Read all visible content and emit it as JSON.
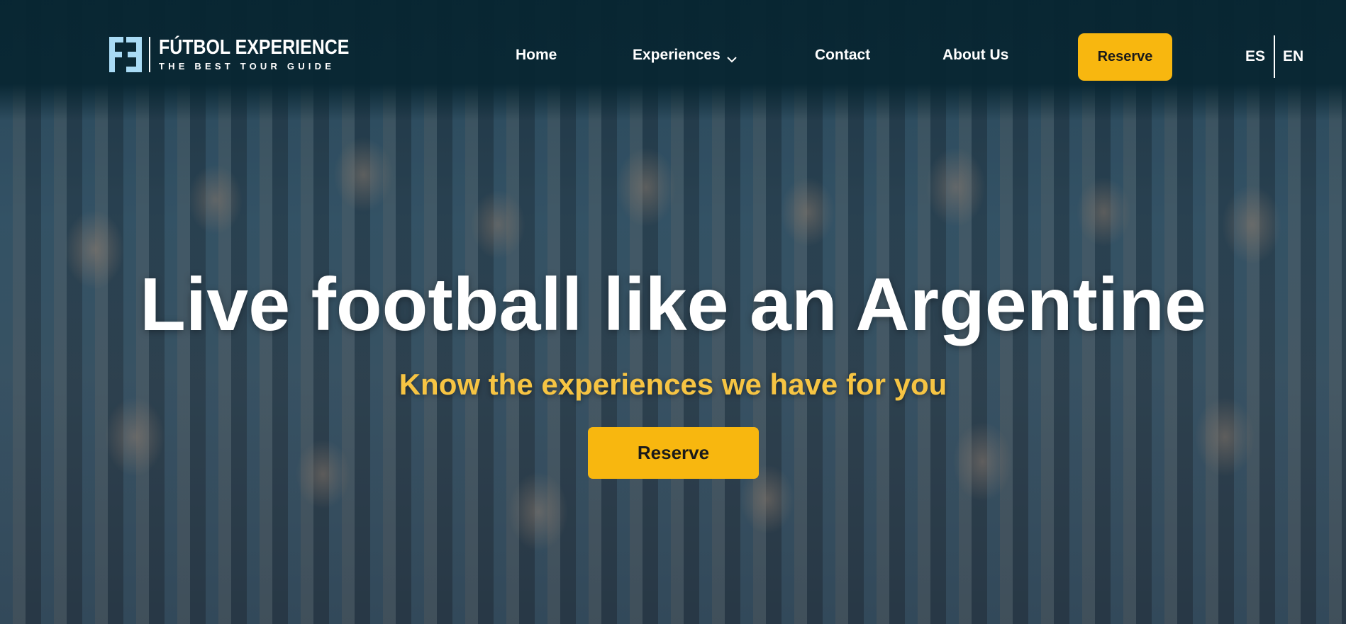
{
  "brand": {
    "title": "FÚTBOL EXPERIENCE",
    "tagline": "THE BEST TOUR GUIDE",
    "logo_icon": "fe-monogram-icon",
    "logo_color": "#a9dbf5"
  },
  "nav": {
    "items": [
      {
        "label": "Home"
      },
      {
        "label": "Experiences",
        "icon": "chevron-down-icon"
      },
      {
        "label": "Contact"
      },
      {
        "label": "About Us"
      }
    ],
    "reserve_label": "Reserve"
  },
  "language": {
    "options": [
      "ES",
      "EN"
    ]
  },
  "hero": {
    "title": "Live football like an Argentine",
    "subtitle": "Know the experiences we have for you",
    "cta_label": "Reserve"
  },
  "colors": {
    "header_bg": "#08262f",
    "accent": "#f8b70f",
    "subtitle": "#f6c443",
    "text": "#ffffff"
  }
}
